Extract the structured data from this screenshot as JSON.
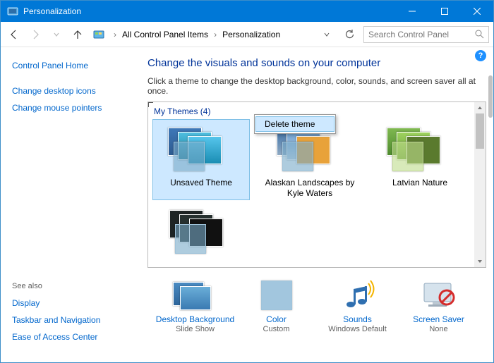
{
  "window": {
    "title": "Personalization"
  },
  "breadcrumb": {
    "item1": "All Control Panel Items",
    "item2": "Personalization"
  },
  "search": {
    "placeholder": "Search Control Panel"
  },
  "sidebar": {
    "home": "Control Panel Home",
    "links": {
      "0": "Change desktop icons",
      "1": "Change mouse pointers"
    },
    "see_also_label": "See also",
    "see_also": {
      "0": "Display",
      "1": "Taskbar and Navigation",
      "2": "Ease of Access Center"
    }
  },
  "main": {
    "heading": "Change the visuals and sounds on your computer",
    "description": "Click a theme to change the desktop background, color, sounds, and screen saver all at once.",
    "section_label": "My Themes (4)",
    "themes": {
      "0": "Unsaved Theme",
      "1": "Alaskan Landscapes by Kyle Waters",
      "2": "Latvian Nature"
    },
    "context_menu": {
      "delete": "Delete theme"
    }
  },
  "bottom": {
    "0": {
      "label": "Desktop Background",
      "sub": "Slide Show"
    },
    "1": {
      "label": "Color",
      "sub": "Custom"
    },
    "2": {
      "label": "Sounds",
      "sub": "Windows Default"
    },
    "3": {
      "label": "Screen Saver",
      "sub": "None"
    }
  }
}
